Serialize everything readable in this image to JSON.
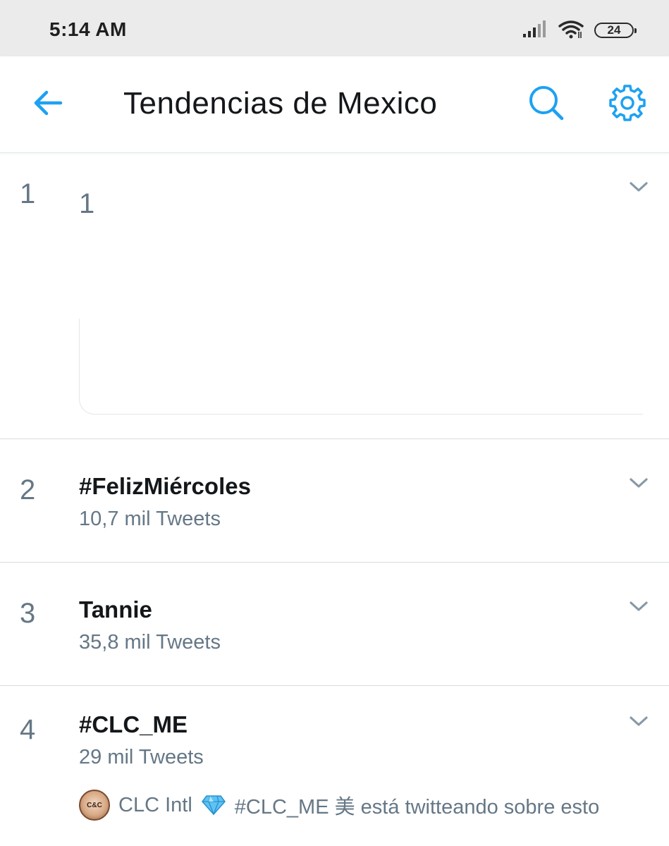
{
  "status_bar": {
    "time": "5:14 AM",
    "battery": "24",
    "icons": [
      "signal-icon",
      "wifi-icon",
      "battery-icon"
    ]
  },
  "header": {
    "title": "Tendencias de Mexico",
    "icons": [
      "back-arrow-icon",
      "search-icon",
      "gear-icon"
    ],
    "accent_color": "#1da1f2"
  },
  "trends": [
    {
      "rank": "1",
      "name": "1",
      "count": ""
    },
    {
      "rank": "2",
      "name": "#FelizMiércoles",
      "count": "10,7 mil Tweets"
    },
    {
      "rank": "3",
      "name": "Tannie",
      "count": "35,8 mil Tweets"
    },
    {
      "rank": "4",
      "name": "#CLC_ME",
      "count": "29 mil Tweets"
    }
  ],
  "context": {
    "avatar_label": "C&C",
    "user": "CLC Intl",
    "text": "#CLC_ME 美 está twitteando sobre esto"
  }
}
